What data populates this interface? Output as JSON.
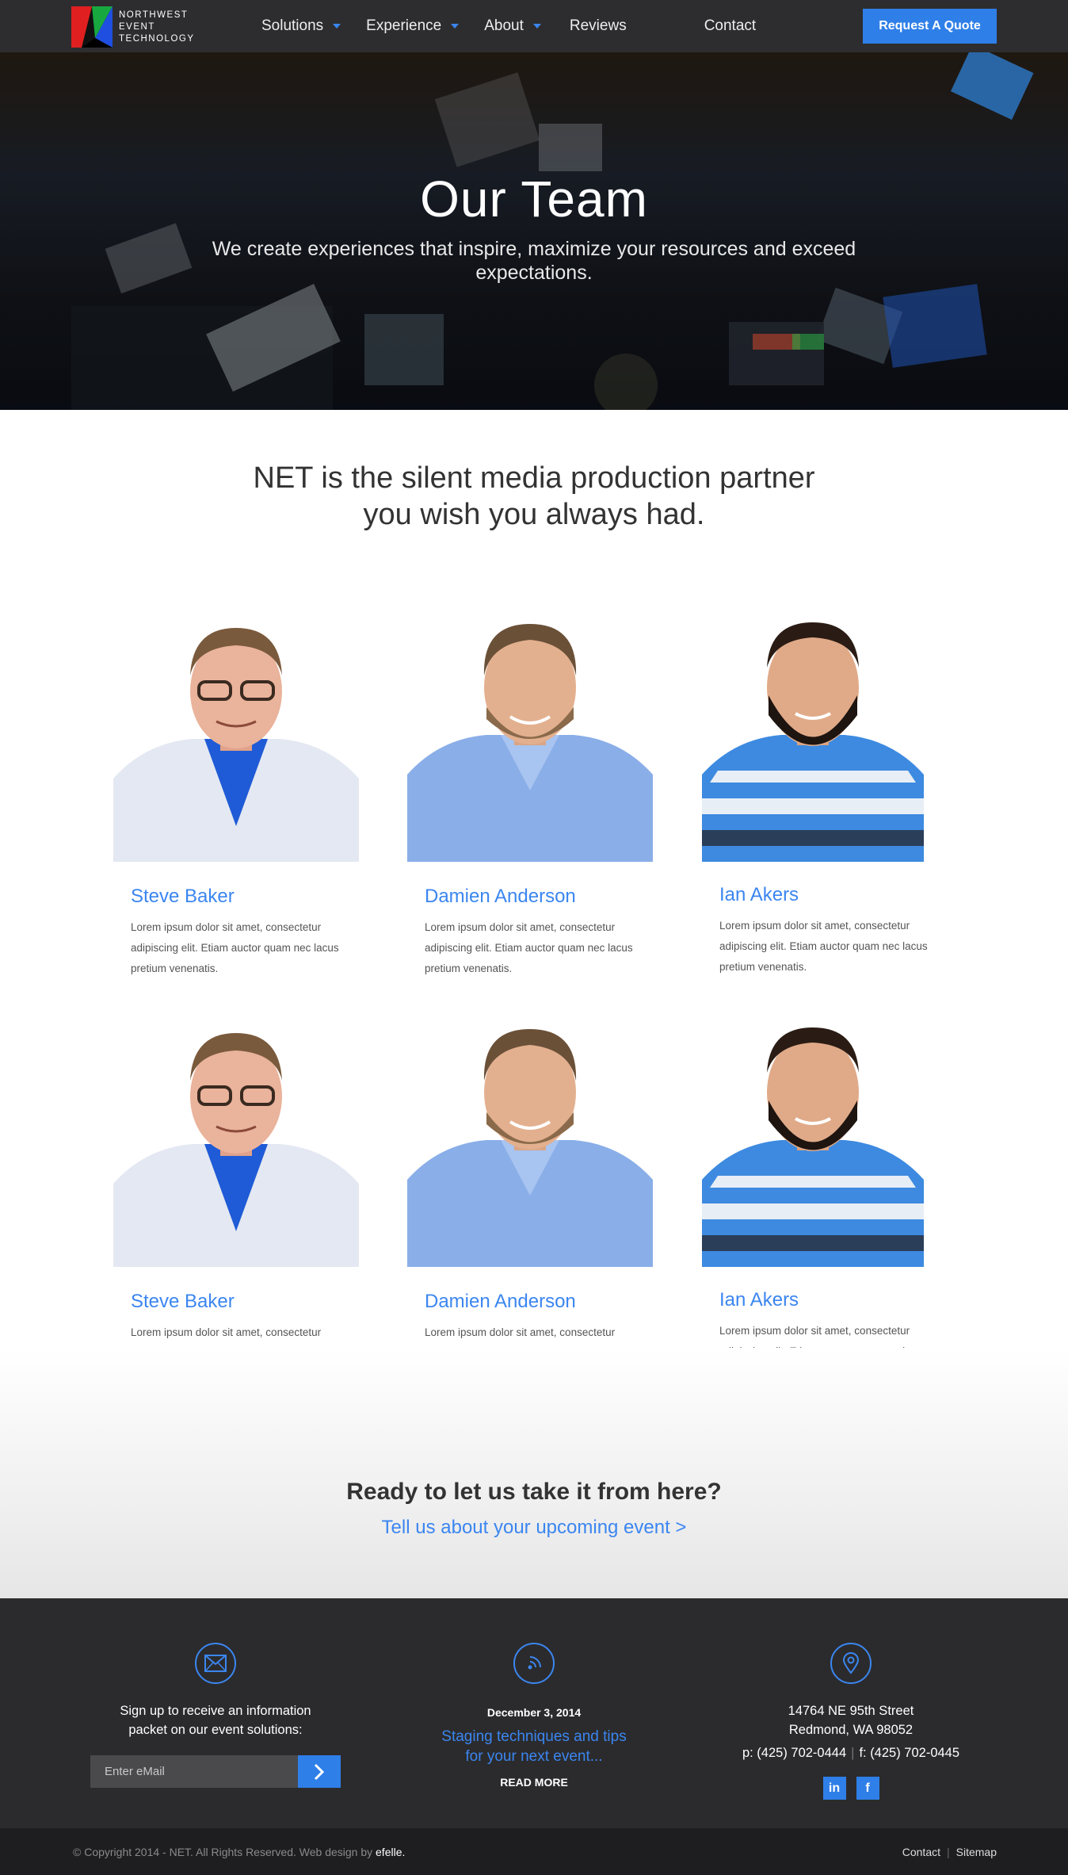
{
  "header": {
    "logo_lines": [
      "NORTHWEST",
      "EVENT",
      "TECHNOLOGY"
    ],
    "nav": [
      {
        "label": "Solutions",
        "has_dropdown": true
      },
      {
        "label": "Experience",
        "has_dropdown": true
      },
      {
        "label": "About",
        "has_dropdown": true
      },
      {
        "label": "Reviews",
        "has_dropdown": false
      },
      {
        "label": "Contact",
        "has_dropdown": false
      }
    ],
    "quote_button": "Request A Quote"
  },
  "hero": {
    "title": "Our Team",
    "subtitle": "We create experiences that inspire, maximize your resources and exceed expectations."
  },
  "intro": {
    "line1": "NET is the silent media production partner",
    "line2": "you wish you always had."
  },
  "team": [
    {
      "name": "Steve Baker",
      "bio": "Lorem ipsum dolor sit amet, consectetur adipiscing elit. Etiam auctor quam nec lacus pretium venenatis."
    },
    {
      "name": "Damien Anderson",
      "bio": "Lorem ipsum dolor sit amet, consectetur adipiscing elit. Etiam auctor quam nec lacus pretium venenatis."
    },
    {
      "name": "Ian Akers",
      "bio": "Lorem ipsum dolor sit amet, consectetur adipiscing elit. Etiam auctor quam nec lacus pretium venenatis."
    },
    {
      "name": "Steve Baker",
      "bio": "Lorem ipsum dolor sit amet, consectetur adipiscing elit. Etiam auctor quam nec lacus pretium venenatis."
    },
    {
      "name": "Damien Anderson",
      "bio": "Lorem ipsum dolor sit amet, consectetur adipiscing elit. Etiam auctor quam nec lacus pretium venenatis."
    },
    {
      "name": "Ian Akers",
      "bio": "Lorem ipsum dolor sit amet, consectetur adipiscing elit. Etiam auctor quam nec lacus pretium venenatis."
    }
  ],
  "cta": {
    "title": "Ready to let us take it from here?",
    "link": "Tell us about your upcoming event >"
  },
  "footer": {
    "signup": {
      "icon": "envelope-icon",
      "line1": "Sign up to receive an information",
      "line2": "packet on our event solutions:",
      "placeholder": "Enter eMail"
    },
    "news": {
      "icon": "feed-icon",
      "date": "December 3, 2014",
      "title_line1": "Staging techniques and tips",
      "title_line2": "for your next event...",
      "read_more": "READ MORE"
    },
    "contact": {
      "icon": "map-pin-icon",
      "address_line1": "14764 NE 95th Street",
      "address_line2": "Redmond, WA 98052",
      "phone": "p: (425) 702-0444",
      "fax": "f: (425) 702-0445",
      "social": [
        {
          "label": "in",
          "icon": "linkedin-icon"
        },
        {
          "label": "f",
          "icon": "facebook-icon"
        }
      ]
    },
    "copyright": "© Copyright 2014 - NET. All Rights Reserved. Web design by",
    "designer": "efelle.",
    "bottom_links": [
      "Contact",
      "Sitemap"
    ]
  },
  "colors": {
    "accent": "#3b86f0",
    "button": "#2f7fe8",
    "header_bg": "#2d2d2f",
    "footer_bg": "#2b2b2d",
    "bottom_bar_bg": "#1e1e20"
  }
}
